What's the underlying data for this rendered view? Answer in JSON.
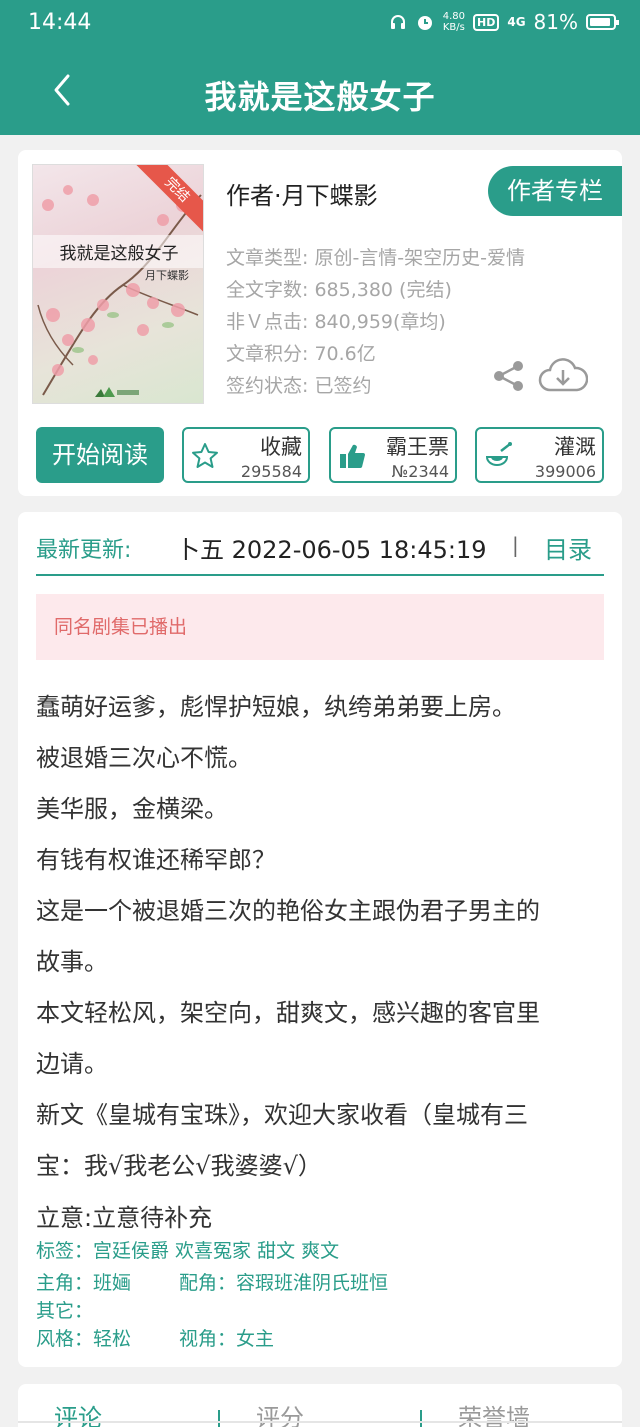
{
  "status_bar": {
    "time": "14:44",
    "speed_top": "4.80",
    "speed_bottom": "KB/s",
    "hd": "HD",
    "network": "4G",
    "battery": "81%"
  },
  "header": {
    "title": "我就是这般女子"
  },
  "book": {
    "cover_badge": "完结",
    "cover_title": "我就是这般女子",
    "cover_author": "月下蝶影",
    "author": "作者·月下蝶影",
    "author_column_button": "作者专栏",
    "meta": {
      "type": "文章类型: 原创-言情-架空历史-爱情",
      "words": "全文字数: 685,380 (完结)",
      "clicks": "非Ｖ点击: 840,959(章均)",
      "score": "文章积分: 70.6亿",
      "contract": "签约状态:  已签约"
    },
    "actions": {
      "read": "开始阅读",
      "favorite_label": "收藏",
      "favorite_count": "295584",
      "vote_label": "霸王票",
      "vote_count": "№2344",
      "water_label": "灌溉",
      "water_count": "399006"
    }
  },
  "update": {
    "label": "最新更新:",
    "text": "卜五  2022-06-05 18:45:19",
    "separator": "|",
    "toc": "目录"
  },
  "notice": "同名剧集已播出",
  "description": [
    "蠢萌好运爹，彪悍护短娘，纨绔弟弟要上房。",
    "被退婚三次心不慌。",
    "美华服，金横梁。",
    "有钱有权谁还稀罕郎？",
    "这是一个被退婚三次的艳俗女主跟伪君子男主的",
    "故事。",
    "本文轻松风，架空向，甜爽文，感兴趣的客官里",
    "边请。",
    "新文《皇城有宝珠》，欢迎大家收看（皇城有三",
    "宝：我√我老公√我婆婆√）"
  ],
  "intent": "立意:立意待补充",
  "tags": {
    "tags_line": "标签：宫廷侯爵 欢喜冤家 甜文 爽文",
    "lead": "主角：班婳",
    "support": "配角：容瑕班淮阴氏班恒",
    "other": "其它：",
    "style": "风格：轻松",
    "view": "视角：女主"
  },
  "tabs": [
    "评论",
    "评分",
    "荣誉墙"
  ],
  "colors": {
    "accent": "#2a9d8a",
    "notice_bg": "#fde9ec",
    "notice_text": "#e06a6a"
  }
}
